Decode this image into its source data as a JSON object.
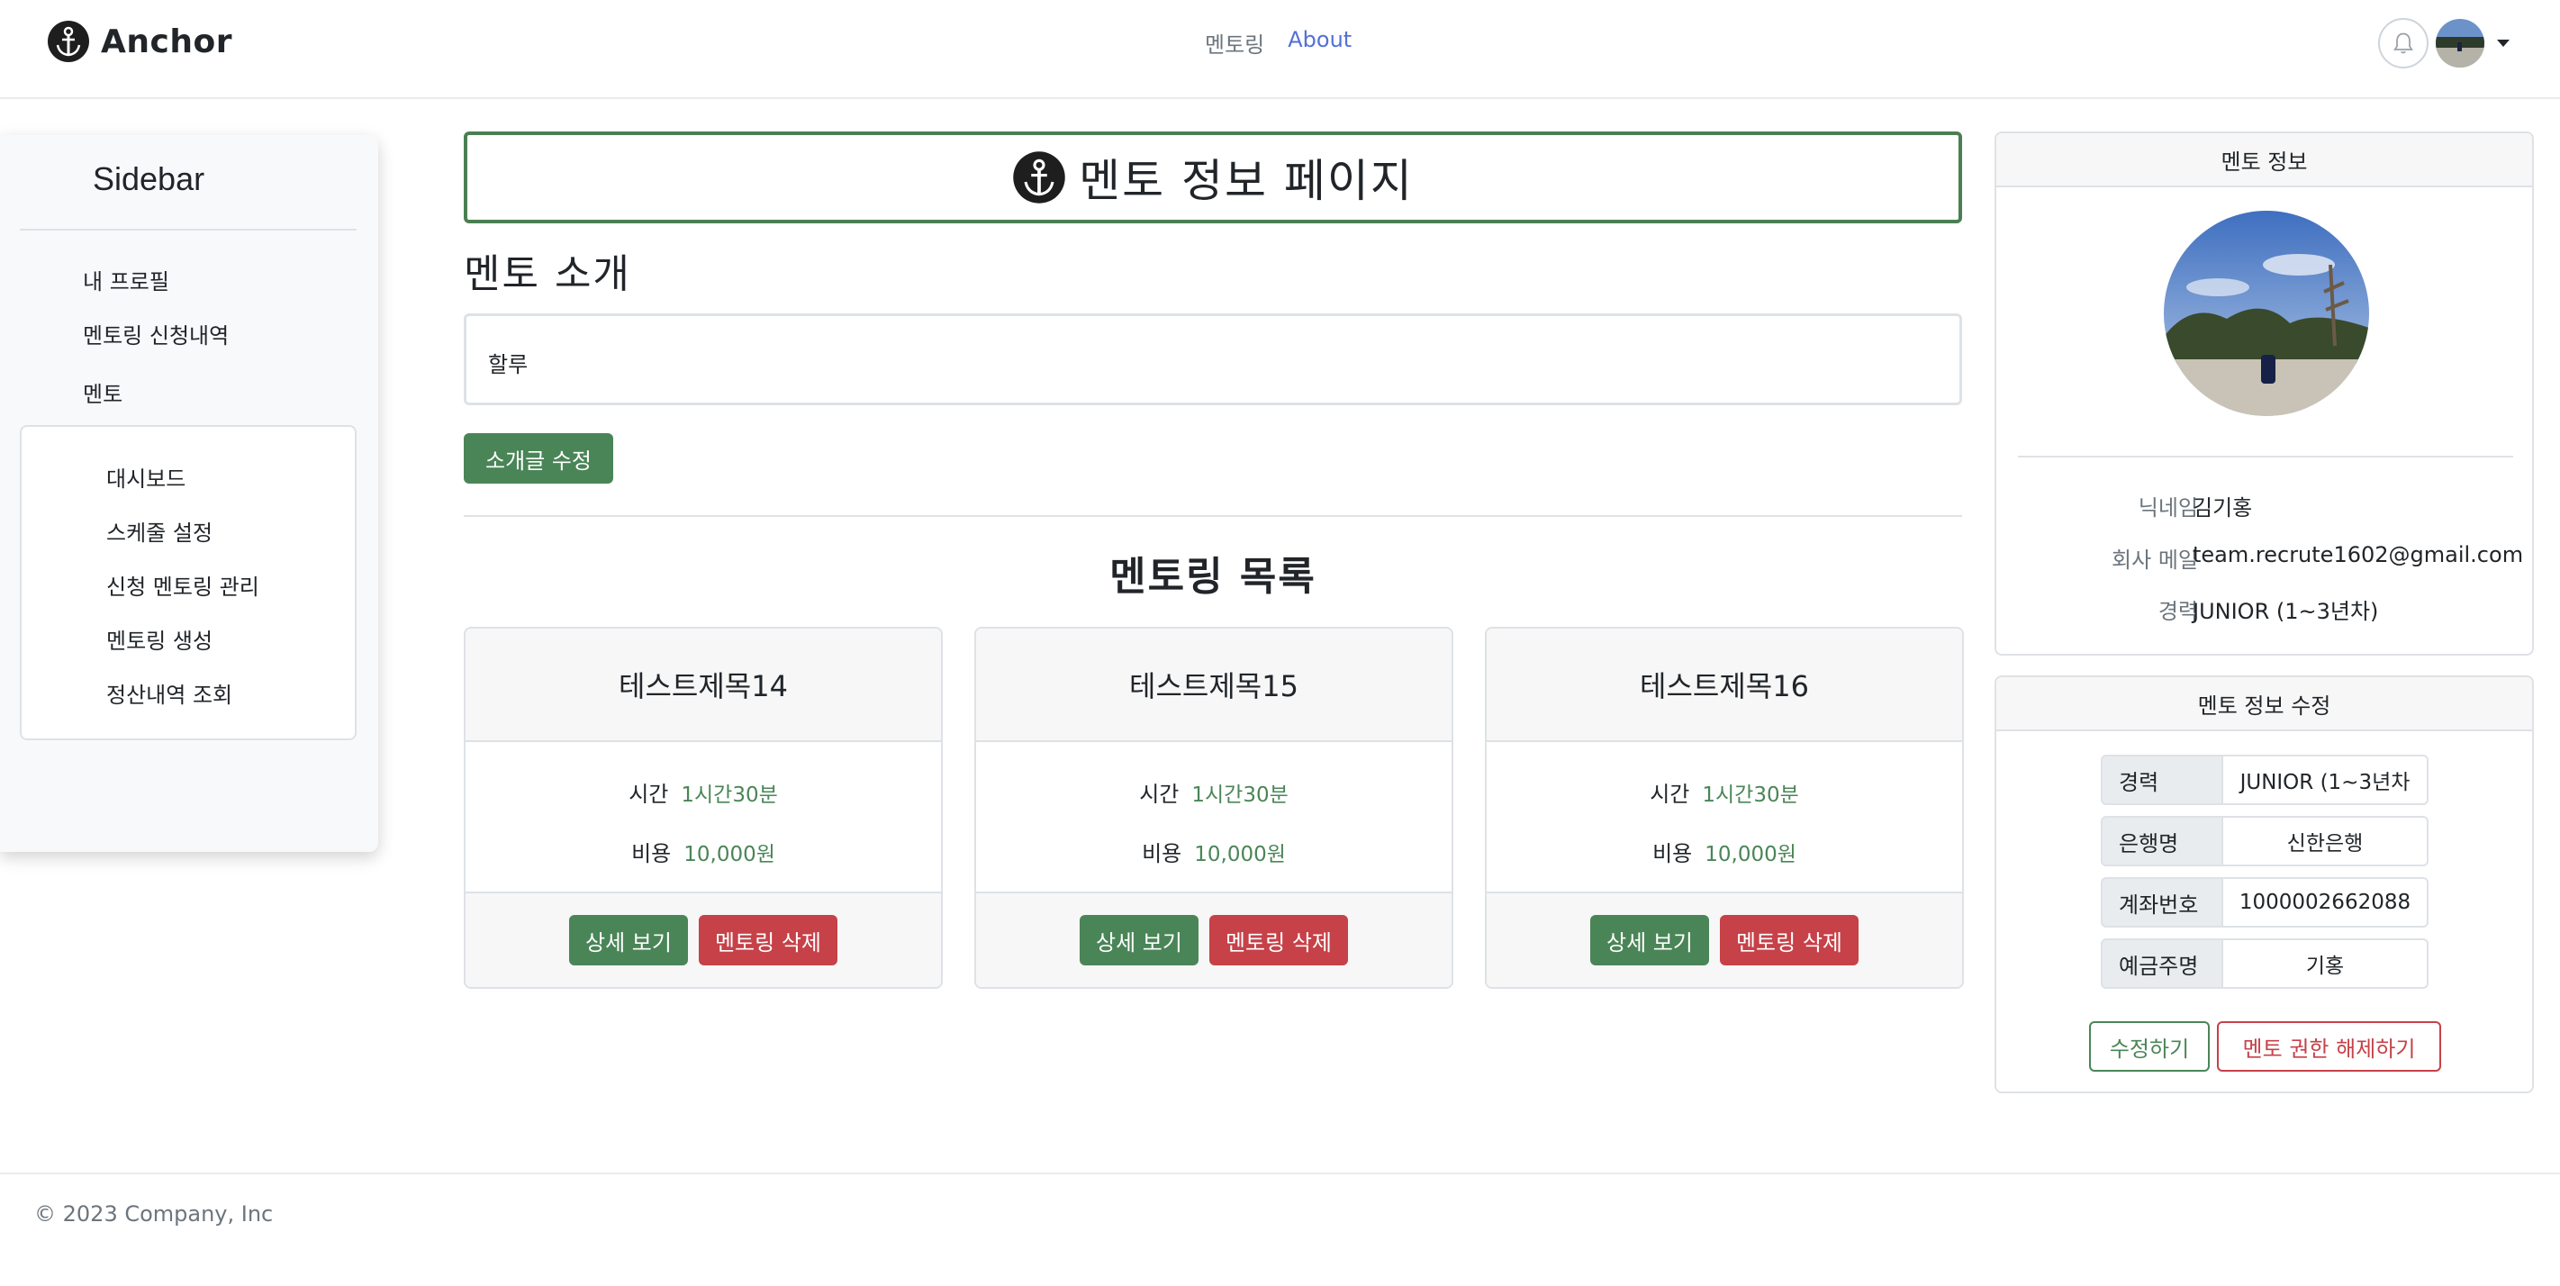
{
  "header": {
    "brand": "Anchor",
    "nav": [
      {
        "label": "멘토링"
      },
      {
        "label": "About"
      }
    ]
  },
  "sidebar": {
    "title": "Sidebar",
    "items": [
      "내 프로필",
      "멘토링 신청내역",
      "멘토"
    ],
    "sub_items": [
      "대시보드",
      "스케줄 설정",
      "신청 멘토링 관리",
      "멘토링 생성",
      "정산내역 조회"
    ]
  },
  "main": {
    "page_title": "멘토 정보 페이지",
    "intro_heading": "멘토 소개",
    "intro_text": "할루",
    "edit_intro_button": "소개글 수정",
    "list_heading": "멘토링 목록",
    "time_label": "시간",
    "cost_label": "비용",
    "detail_button": "상세 보기",
    "delete_button": "멘토링 삭제",
    "cards": [
      {
        "title": "테스트제목14",
        "time": "1시간30분",
        "cost": "10,000원"
      },
      {
        "title": "테스트제목15",
        "time": "1시간30분",
        "cost": "10,000원"
      },
      {
        "title": "테스트제목16",
        "time": "1시간30분",
        "cost": "10,000원"
      }
    ]
  },
  "mentor_info": {
    "header": "멘토 정보",
    "rows": [
      {
        "key": "닉네임",
        "value": "김기홍"
      },
      {
        "key": "회사 메일",
        "value": "team.recrute1602@gmail.com"
      },
      {
        "key": "경력",
        "value": "JUNIOR (1~3년차)"
      }
    ]
  },
  "mentor_edit": {
    "header": "멘토 정보 수정",
    "fields": [
      {
        "key": "경력",
        "value": "JUNIOR (1~3년차"
      },
      {
        "key": "은행명",
        "value": "신한은행"
      },
      {
        "key": "계좌번호",
        "value": "1000002662088"
      },
      {
        "key": "예금주명",
        "value": "기홍"
      }
    ],
    "save_button": "수정하기",
    "revoke_button": "멘토 권한 해제하기"
  },
  "footer": {
    "text": "© 2023 Company, Inc"
  },
  "colors": {
    "primary_green": "#4a8557",
    "danger_red": "#c64148",
    "nav_active": "#5470d6",
    "title_border": "#4a7f52"
  },
  "icons": {
    "brand_logo": "anchor-icon",
    "notifications": "bell-icon",
    "user_menu": "chevron-down-icon"
  }
}
